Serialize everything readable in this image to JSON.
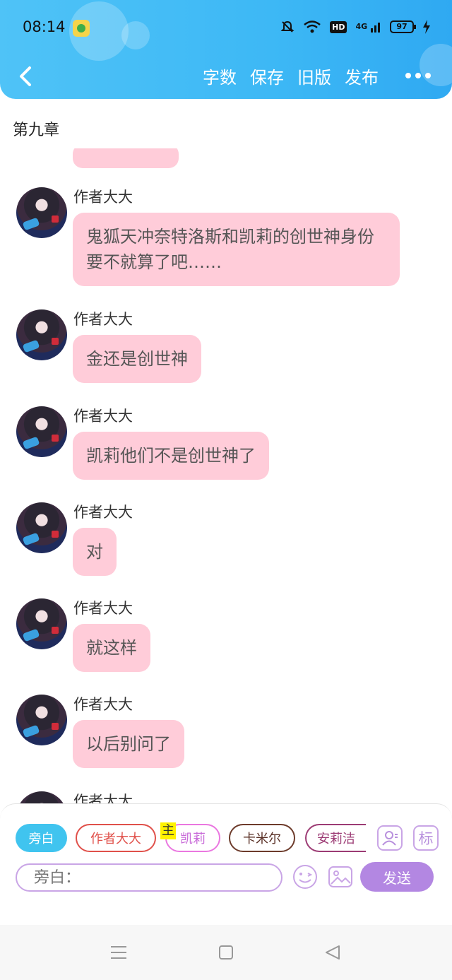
{
  "status_bar": {
    "time": "08:14",
    "hd": "HD",
    "signal_label": "4G",
    "battery": "97"
  },
  "header": {
    "actions": [
      "字数",
      "保存",
      "旧版",
      "发布"
    ],
    "back_icon": "chevron-left-icon",
    "more_icon": "more-dots-icon",
    "colors": {
      "gradient_start": "#4fc3f7",
      "gradient_end": "#2fa9f2"
    }
  },
  "chapter": {
    "title": "第九章"
  },
  "messages": [
    {
      "sender": "作者大大",
      "text": "鬼狐天冲奈特洛斯和凯莉的创世神身份要不就算了吧……"
    },
    {
      "sender": "作者大大",
      "text": "金还是创世神"
    },
    {
      "sender": "作者大大",
      "text": "凯莉他们不是创世神了"
    },
    {
      "sender": "作者大大",
      "text": "对"
    },
    {
      "sender": "作者大大",
      "text": "就这样"
    },
    {
      "sender": "作者大大",
      "text": "以后别问了"
    },
    {
      "sender": "作者大大",
      "text": ""
    }
  ],
  "composer": {
    "characters": [
      "旁白",
      "作者大大",
      "凯莉",
      "卡米尔",
      "安莉洁"
    ],
    "host_badge": "主",
    "tag_button": "标",
    "input_placeholder": "旁白：",
    "send_label": "发送",
    "colors": {
      "bubble": "#ffccd9",
      "send": "#b387e2",
      "accent": "#c9a5e6"
    }
  }
}
